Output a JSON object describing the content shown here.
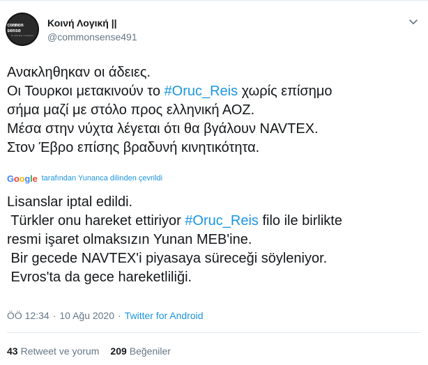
{
  "tweet": {
    "author": {
      "display_name": "Κοινή Λογική ||",
      "handle": "@commonsense491",
      "avatar_text": "common sense",
      "avatar_subtext": "to real war commons"
    },
    "lines": [
      [
        {
          "t": "Ανακληθηκαν οι άδειες."
        }
      ],
      [
        {
          "t": "Οι Τουρκοι μετακινούν το "
        },
        {
          "t": "#Oruc_Reis",
          "tag": true
        },
        {
          "t": " χωρίς επίσημο"
        }
      ],
      [
        {
          "t": "σήμα μαζί με στόλο προς ελληνική ΑΟΖ."
        }
      ],
      [
        {
          "t": "Μέσα στην νύχτα λέγεται ότι θα βγάλουν NAVTEX."
        }
      ],
      [
        {
          "t": "Στον Έβρο επίσης βραδυνή κινητικότητα."
        }
      ]
    ],
    "translation_label": "tarafından Yunanca dilinden çevrildi",
    "google_logo": "Google",
    "translation_lines": [
      [
        {
          "t": "Lisanslar iptal edildi."
        }
      ],
      [
        {
          "t": " Türkler onu hareket ettiriyor "
        },
        {
          "t": "#Oruc_Reis",
          "tag": true
        },
        {
          "t": " filo ile birlikte"
        }
      ],
      [
        {
          "t": "resmi işaret olmaksızın Yunan MEB'ine."
        }
      ],
      [
        {
          "t": " Bir gecede NAVTEX'i piyasaya süreceği söyleniyor."
        }
      ],
      [
        {
          "t": " Evros'ta da gece hareketliliği."
        }
      ]
    ],
    "meta": {
      "time": "ÖÖ 12:34",
      "separator": "·",
      "date": "10 Ağu 2020",
      "source": "Twitter for Android"
    },
    "stats": {
      "retweets_count": "43",
      "retweets_label": "Retweet ve yorum",
      "likes_count": "209",
      "likes_label": "Beğeniler"
    }
  },
  "colors": {
    "text": "#14171a",
    "secondary": "#657786",
    "link": "#1b95e0",
    "divider": "#e1e8ed"
  }
}
